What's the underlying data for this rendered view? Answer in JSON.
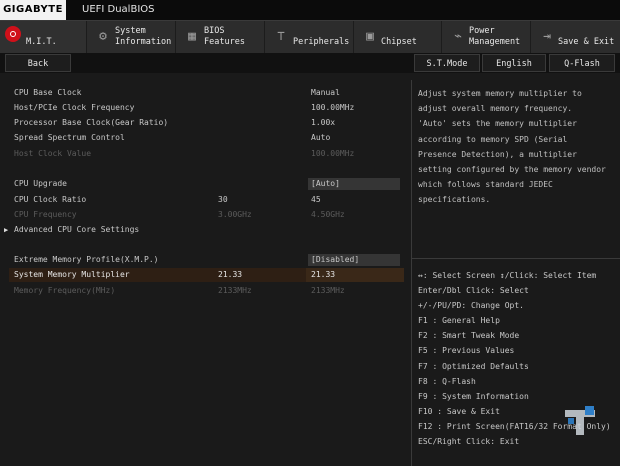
{
  "brand": {
    "logo": "GIGABYTE",
    "title": "UEFI DualBIOS"
  },
  "nav": [
    {
      "line1": "M.I.T.",
      "line2": "",
      "icon": "mit-icon"
    },
    {
      "line1": "System",
      "line2": "Information",
      "icon": "gear-icon"
    },
    {
      "line1": "BIOS",
      "line2": "Features",
      "icon": "bios-chip-icon"
    },
    {
      "line1": "Peripherals",
      "line2": "",
      "icon": "peripherals-icon"
    },
    {
      "line1": "Chipset",
      "line2": "",
      "icon": "chipset-icon"
    },
    {
      "line1": "Power",
      "line2": "Management",
      "icon": "power-icon"
    },
    {
      "line1": "Save & Exit",
      "line2": "",
      "icon": "exit-icon"
    }
  ],
  "buttons": {
    "back": "Back",
    "st_mode": "S.T.Mode",
    "language": "English",
    "qflash": "Q-Flash"
  },
  "settings": [
    {
      "label": "CPU Base Clock",
      "current": "",
      "value": "Manual",
      "dim": false
    },
    {
      "label": "Host/PCIe Clock Frequency",
      "current": "",
      "value": "100.00MHz",
      "dim": false
    },
    {
      "label": "Processor Base Clock(Gear Ratio)",
      "current": "",
      "value": "1.00x",
      "dim": false
    },
    {
      "label": "Spread Spectrum Control",
      "current": "",
      "value": "Auto",
      "dim": false
    },
    {
      "label": "Host Clock Value",
      "current": "",
      "value": "100.00MHz",
      "dim": true
    },
    {
      "label": "CPU Upgrade",
      "current": "",
      "value": "[Auto]",
      "dim": false
    },
    {
      "label": "CPU Clock Ratio",
      "current": "30",
      "value": "45",
      "dim": false
    },
    {
      "label": "CPU Frequency",
      "current": "3.00GHz",
      "value": "4.50GHz",
      "dim": true
    },
    {
      "label": "Advanced CPU Core Settings",
      "current": "",
      "value": "",
      "dim": false
    },
    {
      "label": "Extreme Memory Profile(X.M.P.)",
      "current": "",
      "value": "[Disabled]",
      "dim": false
    },
    {
      "label": "System Memory Multiplier",
      "current": "21.33",
      "value": "21.33",
      "dim": false
    },
    {
      "label": "Memory Frequency(MHz)",
      "current": "2133MHz",
      "value": "2133MHz",
      "dim": true
    }
  ],
  "help_lines": [
    "Adjust system memory multiplier to",
    "adjust overall memory frequency.",
    "'Auto' sets the memory multiplier",
    "according to memory SPD (Serial",
    "Presence Detection), a multiplier",
    "setting configured by the memory vendor",
    "which follows standard JEDEC",
    "specifications."
  ],
  "key_lines": [
    "↔: Select Screen  ↕/Click: Select Item",
    "Enter/Dbl Click: Select",
    "+/-/PU/PD: Change Opt.",
    "F1  : General Help",
    "F2  : Smart Tweak Mode",
    "F5  : Previous Values",
    "F7  : Optimized Defaults",
    "F8  : Q-Flash",
    "F9  : System Information",
    "F10 : Save & Exit",
    "F12 : Print Screen(FAT16/32 Format Only)",
    "ESC/Right Click: Exit"
  ],
  "colors": {
    "accent_red": "#d0101a",
    "highlight_row": "#2e1f14",
    "watermark_blue": "#2f7fc8"
  }
}
